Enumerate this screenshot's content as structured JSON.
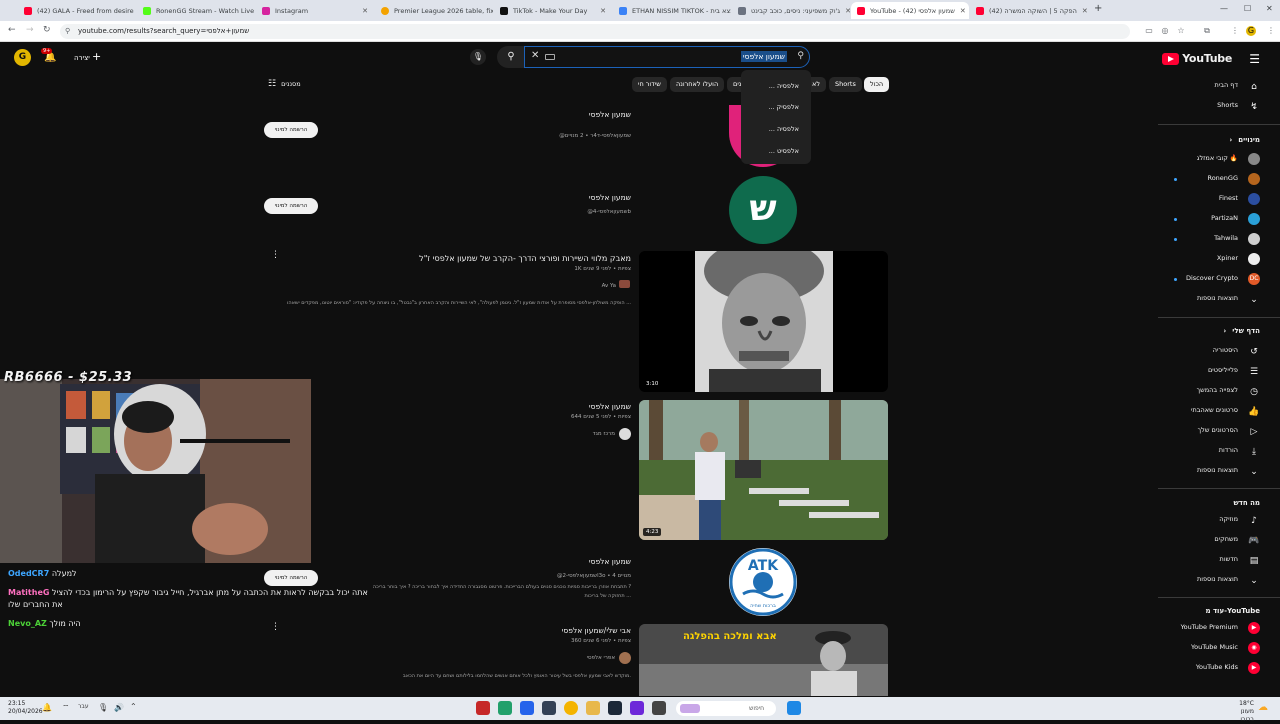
{
  "browser": {
    "tabs": [
      {
        "label": "(42) GALA - Freed from desire",
        "color": "#ff0033"
      },
      {
        "label": "RonenGG Stream - Watch Live",
        "color": "#53fc18"
      },
      {
        "label": "Instagram",
        "color": "#d6249f"
      },
      {
        "label": "Premier League 2026 table, fixt",
        "color": "#f4a300"
      },
      {
        "label": "TikTok - Make Your Day",
        "color": "#111111"
      },
      {
        "label": "ETHAN NISSIM TIKTOK - מי נמצא בית",
        "color": "#3b82f6"
      },
      {
        "label": "ג'וק משפיעני: ניסים, כוכב קבינט",
        "color": "#6b7280"
      },
      {
        "label": "YouTube - שמעון אלפסי (42)",
        "color": "#ff0033"
      },
      {
        "label": "(42) הפקה 5 | השוקה המשרה",
        "color": "#ff0033"
      }
    ],
    "url": "youtube.com/results?search_query=שמעון+אלפסי"
  },
  "header": {
    "logo": "YouTube",
    "search_value": "שמעון אלפסי",
    "create_label": "יצירה",
    "notif_count": "9+",
    "avatar_letter": "G"
  },
  "suggestions": [
    "... אלפסיה",
    "... אלפסיק",
    "... אלפסיה",
    "... אלפסיט"
  ],
  "chips": [
    "הכול",
    "Shorts",
    "לא",
    "נים",
    "הועלו לאחרונה",
    "שידור חי"
  ],
  "filters_label": "מסננים",
  "sidebar": {
    "top": [
      {
        "label": "דף הבית",
        "icon": "⌂"
      },
      {
        "label": "Shorts",
        "icon": "↯"
      }
    ],
    "subs_heading": "מינויים",
    "subs": [
      {
        "label": "קובי אמזלג 🔥",
        "color": "#888888",
        "dot": false
      },
      {
        "label": "RonenGG",
        "color": "#b5651d",
        "dot": true
      },
      {
        "label": "Finest",
        "color": "#2b4ea0",
        "dot": false
      },
      {
        "label": "PartizaN",
        "color": "#2aa0d8",
        "dot": true
      },
      {
        "label": "Tahwila",
        "color": "#cfcfcf",
        "dot": true
      },
      {
        "label": "Xpiner",
        "color": "#eeeeee",
        "dot": false
      },
      {
        "label": "Discover Crypto",
        "color": "#e25a28",
        "dot": true
      }
    ],
    "subs_more": "תוצאות נוספות",
    "you_heading": "הדף שלי",
    "you": [
      {
        "label": "היסטוריה",
        "icon": "↺"
      },
      {
        "label": "פלייליסטים",
        "icon": "☰"
      },
      {
        "label": "לצפייה בהמשך",
        "icon": "◷"
      },
      {
        "label": "סרטונים שאהבתי",
        "icon": "👍"
      },
      {
        "label": "הסרטונים שלך",
        "icon": "▷"
      },
      {
        "label": "הורדות",
        "icon": "⤓"
      }
    ],
    "you_more": "תוצאות נוספות",
    "new_heading": "מה חדש",
    "new": [
      {
        "label": "מוזיקה",
        "icon": "♪"
      },
      {
        "label": "משחקים",
        "icon": "🎮"
      },
      {
        "label": "חדשות",
        "icon": "▤"
      }
    ],
    "new_more": "תוצאות נוספות",
    "more_heading": "עוד מ-YouTube",
    "more": [
      {
        "label": "YouTube Premium",
        "color": "#ff0033"
      },
      {
        "label": "YouTube Music",
        "color": "#ff0033"
      },
      {
        "label": "YouTube Kids",
        "color": "#ff0033"
      }
    ]
  },
  "results": {
    "r1": {
      "title": "שמעון אלפסי",
      "meta": "@שמעוןאלפסי-ד4ר • 2 מנויים",
      "sub": "הרשמה למינוי"
    },
    "r2": {
      "title": "שמעון אלפסי",
      "meta": "@שמעוןאלפסי-4b",
      "sub": "הרשמה למינוי",
      "avatar_letter": "ש"
    },
    "r3": {
      "title": "מאבק מלווי השיירות ופורצי הדרך -הקרב של שמעון אלפסי ז\"ל",
      "meta": "1K צפיות • לפני 9 שנים",
      "channel": "Av Ya",
      "desc": "הופקה משולחן-אלפסי מסופרת על אודות שמעון ז\"ל. ניטמן לפעולה\", לאי השיירות והקרב האחרון ב\"נבטל\", בו ניצחה על פקודיו: \"סוראים יוטונו, מפקדים ישאהו ...",
      "duration": "3:10"
    },
    "r4": {
      "title": "שמעון אלפסי",
      "meta": "644 צפיות • לפני 5 שנים",
      "channel": "מרכז מגד",
      "duration": "4:23"
    },
    "r5": {
      "title": "שמעון אלפסי",
      "meta": "@שמעוןאלפסי-2l3o • 4 מנויים",
      "desc1": "תתבחת אוזרן ברייבות סמיות נוכנים סנוים בעולם הברייכות. פרטוט מסגבורה החדידה איך לבחור בריכה ? איך בוחר בריכה ?",
      "desc2": "תחזוקה של בריכות ...",
      "sub": "הרשמה למינוי",
      "logo_text": "ברכות שחיה"
    },
    "r6": {
      "title": "אבי שלי/שמעון אלפסי",
      "meta": "360 צפיות • לפני 6 שנים",
      "channel": "אפרי אלפסי",
      "desc": "מוקדש לאבי שמעון אלפסי בשל עיטור האומץ ולכל אותם אנשים שהלחמו בלילותם ושחם עד היום את הכאב.",
      "thumb_text": "אבא ומלכה בהפלגה"
    }
  },
  "stream": {
    "overlay_text": "RB6666 - $25.33",
    "chat": [
      {
        "user": "OdedCR7",
        "user_color": "#3ea6ff",
        "text": "למעלה"
      },
      {
        "user": "MatitheG",
        "user_color": "#ff70c0",
        "text": "אתה יכול בבקשה לראות את הכתבה על מתן אברגיל, חייל גיבור שקפץ על הרימון בכדי להציל את החברים שלו"
      },
      {
        "user": "Nevo_AZ",
        "user_color": "#4cd137",
        "text": "היה מולך"
      }
    ]
  },
  "taskbar": {
    "time": "23:15",
    "date": "20/04/2026",
    "search_placeholder": "חיפוש",
    "weather": "18°C",
    "weather_desc": "מעונן ברובו",
    "lang": "עבר"
  }
}
